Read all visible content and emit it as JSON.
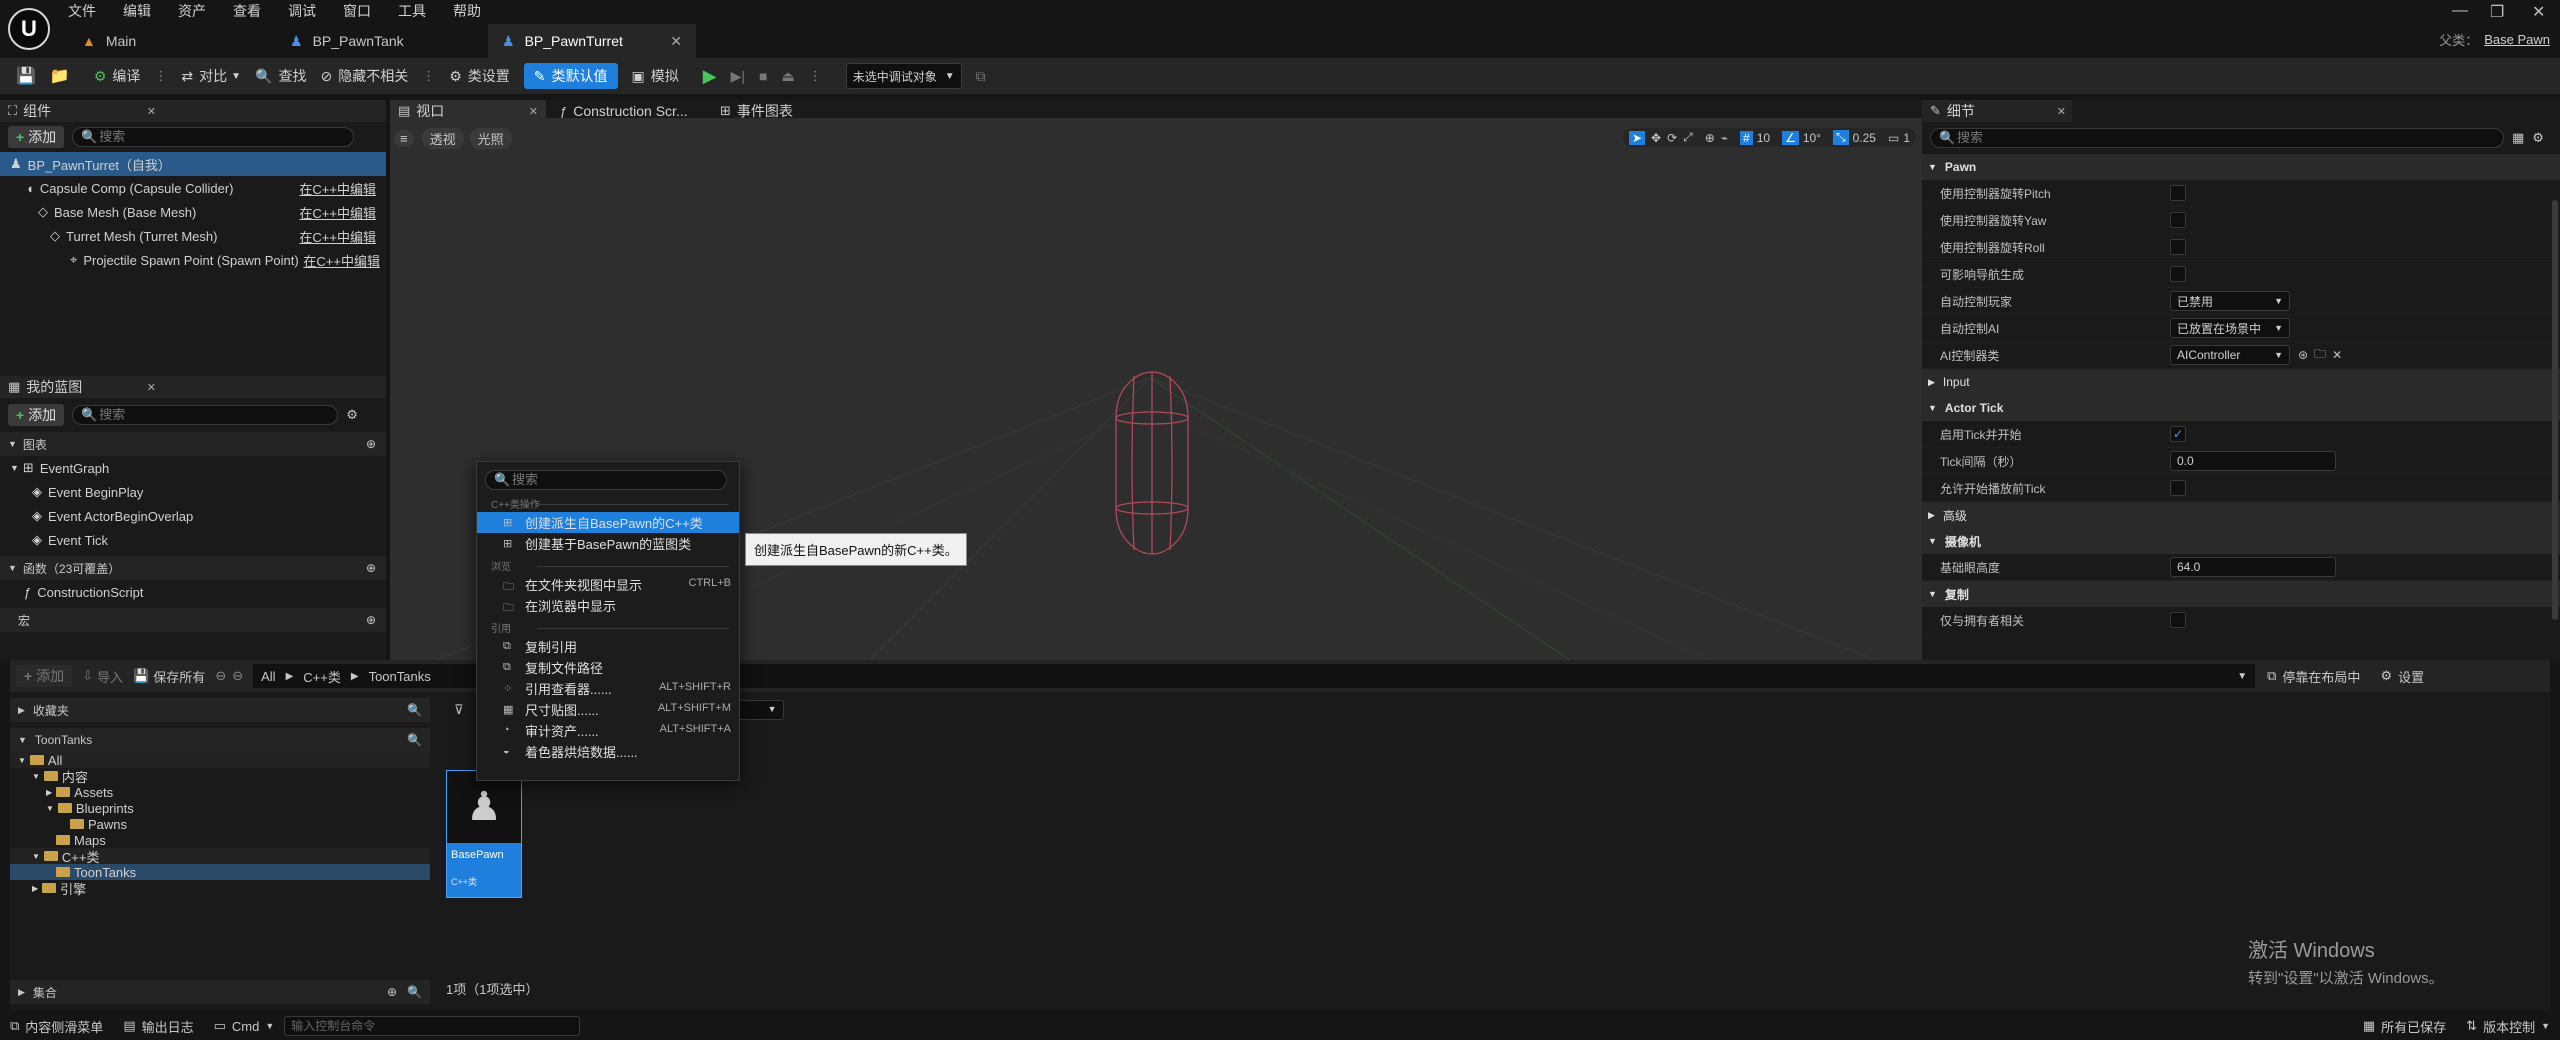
{
  "menu": [
    "文件",
    "编辑",
    "资产",
    "查看",
    "调试",
    "窗口",
    "工具",
    "帮助"
  ],
  "doc_tabs": [
    {
      "label": "Main"
    },
    {
      "label": "BP_PawnTank"
    },
    {
      "label": "BP_PawnTurret"
    }
  ],
  "parent_class": {
    "label": "父类：",
    "value": "Base Pawn"
  },
  "toolbar": {
    "compile": "编译",
    "diff": "对比",
    "find": "查找",
    "hide_unrelated": "隐藏不相关",
    "class_settings": "类设置",
    "class_defaults": "类默认值",
    "simulate": "模拟",
    "debug_target": "未选中调试对象"
  },
  "components": {
    "tab": "组件",
    "add": "添加",
    "search_placeholder": "搜索",
    "edit_in_cpp": "在C++中编辑",
    "items": [
      {
        "label": "BP_PawnTurret（自我）"
      },
      {
        "label": "Capsule Comp (Capsule Collider)"
      },
      {
        "label": "Base Mesh (Base Mesh)"
      },
      {
        "label": "Turret Mesh (Turret Mesh)"
      },
      {
        "label": "Projectile Spawn Point (Spawn Point)"
      }
    ]
  },
  "my_blueprint": {
    "tab": "我的蓝图",
    "add": "添加",
    "search_placeholder": "搜索",
    "graphs": "图表",
    "event_graph": "EventGraph",
    "events": [
      "Event BeginPlay",
      "Event ActorBeginOverlap",
      "Event Tick"
    ],
    "functions": "函数（23可覆盖）",
    "construction_script": "ConstructionScript",
    "macros": "宏"
  },
  "editor_tabs": {
    "viewport": "视口",
    "construction": "Construction Scr...",
    "event_graph": "事件图表"
  },
  "viewport": {
    "perspective": "透视",
    "lit": "光照",
    "grid": "10",
    "angle": "10°",
    "scale": "0.25",
    "cam": "1"
  },
  "context_menu": {
    "search_placeholder": "搜索",
    "sec_cpp": "C++类操作",
    "create_cpp": "创建派生自BasePawn的C++类",
    "create_bp": "创建基于BasePawn的蓝图类",
    "sec_explore": "浏览",
    "show_in_folder": "在文件夹视图中显示",
    "show_in_folder_sc": "CTRL+B",
    "show_in_explorer": "在浏览器中显示",
    "sec_ref": "引用",
    "copy_ref": "复制引用",
    "copy_path": "复制文件路径",
    "ref_viewer": "引用查看器......",
    "ref_viewer_sc": "ALT+SHIFT+R",
    "size_map": "尺寸贴图......",
    "size_map_sc": "ALT+SHIFT+M",
    "audit": "审计资产......",
    "audit_sc": "ALT+SHIFT+A",
    "shader_cache": "着色器烘焙数据......"
  },
  "tooltip": "创建派生自BasePawn的新C++类。",
  "details": {
    "tab": "细节",
    "search_placeholder": "搜索",
    "cat_pawn": "Pawn",
    "use_pitch": "使用控制器旋转Pitch",
    "use_yaw": "使用控制器旋转Yaw",
    "use_roll": "使用控制器旋转Roll",
    "nav_gen": "可影响导航生成",
    "auto_player": "自动控制玩家",
    "auto_player_val": "已禁用",
    "auto_ai": "自动控制AI",
    "auto_ai_val": "已放置在场景中",
    "ai_class": "AI控制器类",
    "ai_class_val": "AIController",
    "cat_input": "Input",
    "cat_tick": "Actor Tick",
    "tick_start": "启用Tick并开始",
    "tick_interval": "Tick间隔（秒）",
    "tick_interval_val": "0.0",
    "tick_paused": "允许开始播放前Tick",
    "cat_advanced": "高级",
    "cat_camera": "摄像机",
    "eye_height": "基础眼高度",
    "eye_height_val": "64.0",
    "cat_replication": "复制",
    "only_owner": "仅与拥有者相关"
  },
  "content_browser": {
    "add": "添加",
    "import": "导入",
    "save_all": "保存所有",
    "path": [
      "All",
      "C++类",
      "ToonTanks"
    ],
    "dock": "停靠在布局中",
    "settings": "设置",
    "favorites": "收藏夹",
    "project": "ToonTanks",
    "tree": [
      {
        "label": "All",
        "depth": 0
      },
      {
        "label": "内容",
        "depth": 1
      },
      {
        "label": "Assets",
        "depth": 2
      },
      {
        "label": "Blueprints",
        "depth": 2
      },
      {
        "label": "Pawns",
        "depth": 3
      },
      {
        "label": "Maps",
        "depth": 2
      },
      {
        "label": "C++类",
        "depth": 1
      },
      {
        "label": "ToonTanks",
        "depth": 2
      },
      {
        "label": "引擎",
        "depth": 1
      }
    ],
    "collections": "集合",
    "asset_name": "BasePawn",
    "asset_type": "C++类",
    "item_count": "1项（1项选中）"
  },
  "watermark": {
    "line1": "激活 Windows",
    "line2": "转到\"设置\"以激活 Windows。"
  },
  "status": {
    "drawer": "内容侧滑菜单",
    "log": "输出日志",
    "cmd": "Cmd",
    "console_placeholder": "输入控制台命令",
    "saved": "所有已保存",
    "source_control": "版本控制"
  },
  "colors": {
    "accent": "#1e7fdc",
    "folder": "#c9a24a",
    "selection": "#2a5a8a"
  }
}
